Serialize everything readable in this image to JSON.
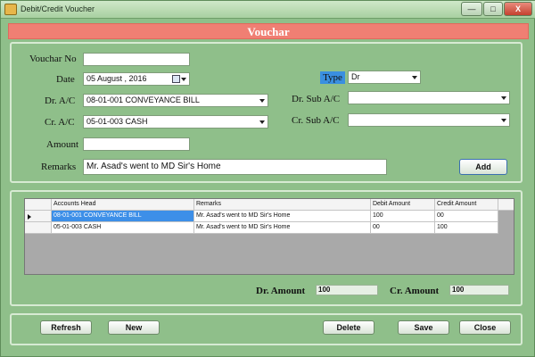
{
  "window": {
    "title": "Debit/Credit Voucher",
    "min": "—",
    "max": "□",
    "close": "X"
  },
  "header": {
    "title": "Vouchar"
  },
  "form": {
    "voucher_no": {
      "label": "Vouchar No",
      "value": ""
    },
    "date": {
      "label": "Date",
      "value": "05    August    , 2016"
    },
    "type": {
      "label": "Type",
      "value": "Dr"
    },
    "dr_ac": {
      "label": "Dr. A/C",
      "value": "08-01-001 CONVEYANCE BILL"
    },
    "dr_sub_ac": {
      "label": "Dr. Sub A/C",
      "value": ""
    },
    "cr_ac": {
      "label": "Cr. A/C",
      "value": "05-01-003 CASH"
    },
    "cr_sub_ac": {
      "label": "Cr. Sub A/C",
      "value": ""
    },
    "amount": {
      "label": "Amount",
      "value": ""
    },
    "remarks": {
      "label": "Remarks",
      "value": "Mr. Asad's went to MD Sir's Home"
    },
    "add_label": "Add"
  },
  "grid": {
    "columns": [
      "Accounts Head",
      "Remarks",
      "Debit Amount",
      "Credit Amount"
    ],
    "rows": [
      [
        "08-01-001 CONVEYANCE BILL",
        "Mr. Asad's went to MD Sir's Home",
        "100",
        "00"
      ],
      [
        "05-01-003 CASH",
        "Mr. Asad's went to MD Sir's Home",
        "00",
        "100"
      ]
    ]
  },
  "totals": {
    "dr_label": "Dr. Amount",
    "dr_value": "100",
    "cr_label": "Cr. Amount",
    "cr_value": "100"
  },
  "buttons": {
    "refresh": "Refresh",
    "new": "New",
    "delete": "Delete",
    "save": "Save",
    "close": "Close"
  },
  "colors": {
    "background": "#8fbf8a",
    "header": "#f07f73",
    "selection": "#3d8fe8"
  }
}
